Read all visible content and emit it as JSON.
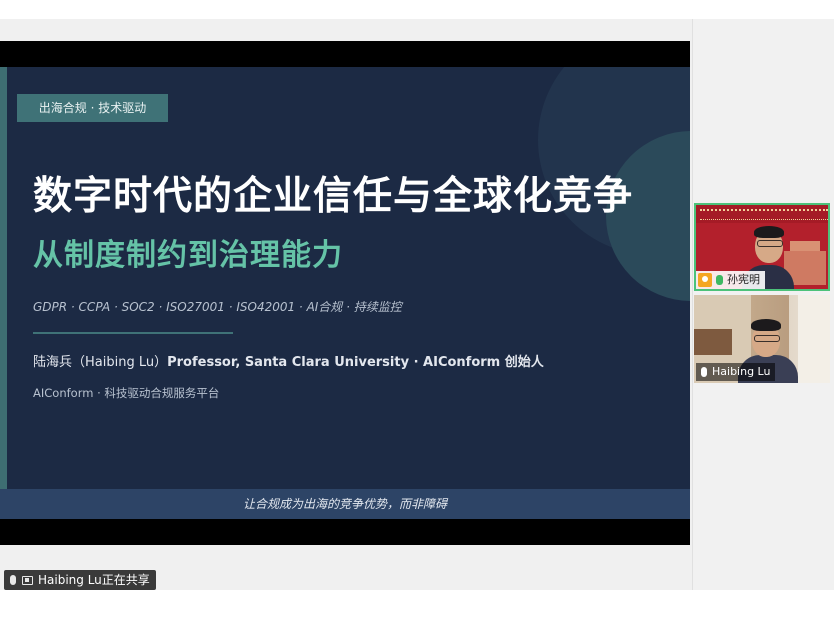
{
  "slide": {
    "tag": "出海合规 · 技术驱动",
    "title": "数字时代的企业信任与全球化竞争",
    "subtitle": "从制度制约到治理能力",
    "keywords": "GDPR · CCPA · SOC2 · ISO27001 · ISO42001 · AI合规 · 持续监控",
    "presenter_name": "陆海兵（Haibing Lu）",
    "presenter_desc": "Professor, Santa Clara University · AIConform 创始人",
    "platform": "AIConform · 科技驱动合规服务平台",
    "footer": "让合规成为出海的竞争优势，而非障碍"
  },
  "participants": [
    {
      "name": "孙宪明",
      "icon": "mic-icon",
      "active_speaker": true
    },
    {
      "name": "Haibing Lu",
      "icon": "mic-icon",
      "active_speaker": false
    }
  ],
  "share_status": {
    "text": "Haibing Lu正在共享"
  },
  "colors": {
    "slide_bg": "#1c2a44",
    "accent_teal": "#3f7277",
    "subtitle_green": "#65c3a7",
    "active_border": "#4cc27a"
  }
}
